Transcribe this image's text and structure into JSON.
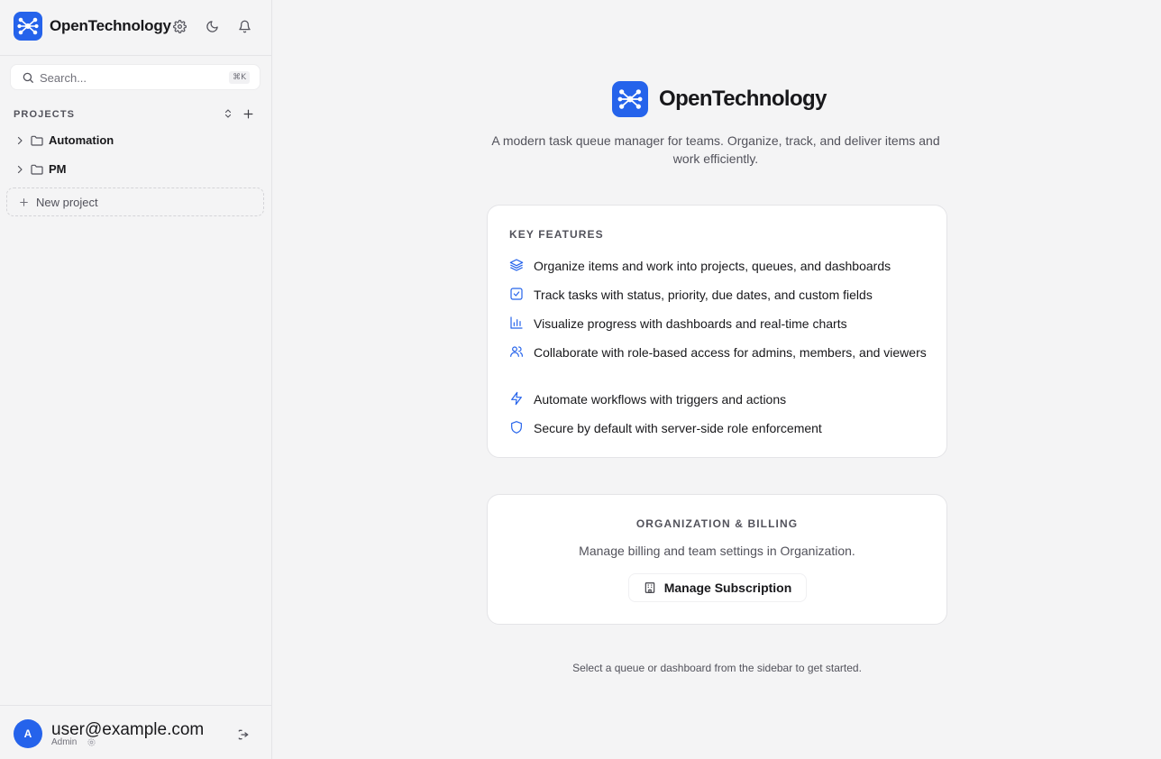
{
  "brand": {
    "name": "OpenTechnology",
    "accent": "#2563eb"
  },
  "sidebar": {
    "search": {
      "placeholder": "Search...",
      "shortcut": "⌘K"
    },
    "projects_label": "PROJECTS",
    "projects": [
      {
        "name": "Automation"
      },
      {
        "name": "PM"
      }
    ],
    "new_project_label": "New project",
    "user": {
      "initial": "A",
      "email": "user@example.com",
      "role": "Admin"
    }
  },
  "main": {
    "title": "OpenTechnology",
    "tagline": "A modern task queue manager for teams. Organize, track, and deliver items and work efficiently.",
    "features": {
      "heading": "KEY FEATURES",
      "items": [
        {
          "icon": "layers-icon",
          "text": "Organize items and work into projects, queues, and dashboards"
        },
        {
          "icon": "checkbox-icon",
          "text": "Track tasks with status, priority, due dates, and custom fields"
        },
        {
          "icon": "bar-chart-icon",
          "text": "Visualize progress with dashboards and real-time charts"
        },
        {
          "icon": "users-icon",
          "text": "Collaborate with role-based access for admins, members, and viewers"
        },
        {
          "icon": "zap-icon",
          "text": "Automate workflows with triggers and actions"
        },
        {
          "icon": "shield-icon",
          "text": "Secure by default with server-side role enforcement"
        }
      ]
    },
    "billing": {
      "heading": "ORGANIZATION & BILLING",
      "description": "Manage billing and team settings in Organization.",
      "button_label": "Manage Subscription"
    },
    "footer_hint": "Select a queue or dashboard from the sidebar to get started."
  }
}
